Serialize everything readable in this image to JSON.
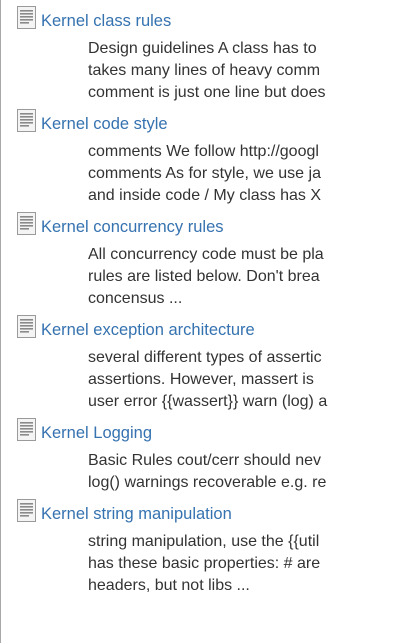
{
  "results": [
    {
      "title": "Kernel class rules",
      "excerpt": [
        "Design guidelines A class has to",
        "takes many lines of heavy comm",
        "comment is just one line but does"
      ]
    },
    {
      "title": "Kernel code style",
      "excerpt": [
        "comments We follow http://googl",
        "comments As for style, we use ja",
        "and inside code / My class has X"
      ]
    },
    {
      "title": "Kernel concurrency rules",
      "excerpt": [
        "All concurrency code must be pla",
        "rules are listed below. Don't brea",
        "concensus ..."
      ]
    },
    {
      "title": "Kernel exception architecture",
      "excerpt": [
        "several different types of assertic",
        "assertions. However, massert is",
        "user error {{wassert}} warn (log) a"
      ]
    },
    {
      "title": "Kernel Logging",
      "excerpt": [
        "Basic Rules cout/cerr should nev",
        "log() warnings recoverable e.g. re"
      ]
    },
    {
      "title": "Kernel string manipulation",
      "excerpt": [
        "string manipulation, use the {{util",
        "has these basic properties: # are",
        "headers, but not libs ..."
      ]
    }
  ],
  "icon": "document-icon",
  "link_color": "#3572b0",
  "text_color": "#333333"
}
